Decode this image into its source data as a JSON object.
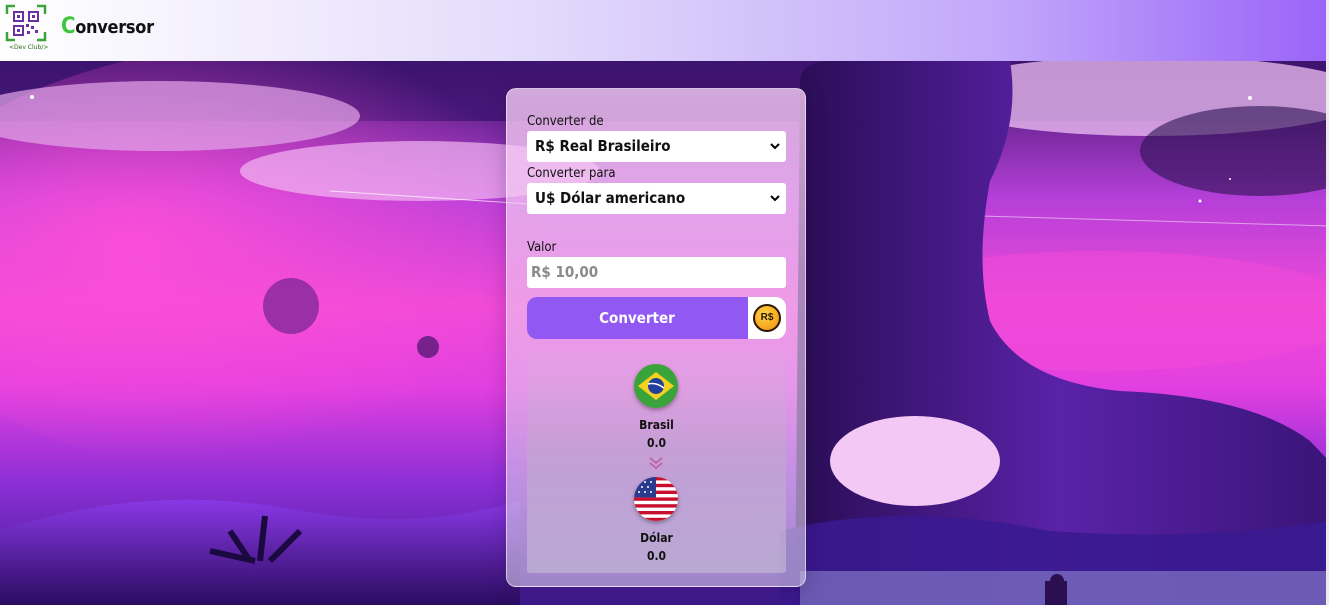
{
  "header": {
    "logo_text": "<Dev Club/>",
    "title_first_letter": "C",
    "title_rest": "onversor"
  },
  "form": {
    "from_label": "Converter de",
    "from_selected": "R$ Real Brasileiro",
    "to_label": "Converter para",
    "to_selected": "U$ Dólar americano",
    "value_label": "Valor",
    "value_placeholder": "R$ 10,00",
    "convert_button": "Converter",
    "coin_symbol": "R$"
  },
  "result": {
    "from_currency_name": "Brasil",
    "from_value": "0.0",
    "to_currency_name": "Dólar",
    "to_value": "0.0"
  },
  "colors": {
    "accent": "#9258f4",
    "title_accent": "#3cc83c"
  },
  "icons": {
    "logo": "dev-club-qr-logo",
    "coin": "real-coin-icon",
    "from_flag": "brazil-flag-icon",
    "to_flag": "usa-flag-icon",
    "arrow": "double-chevron-down-icon",
    "select_chevron": "chevron-down-icon"
  }
}
